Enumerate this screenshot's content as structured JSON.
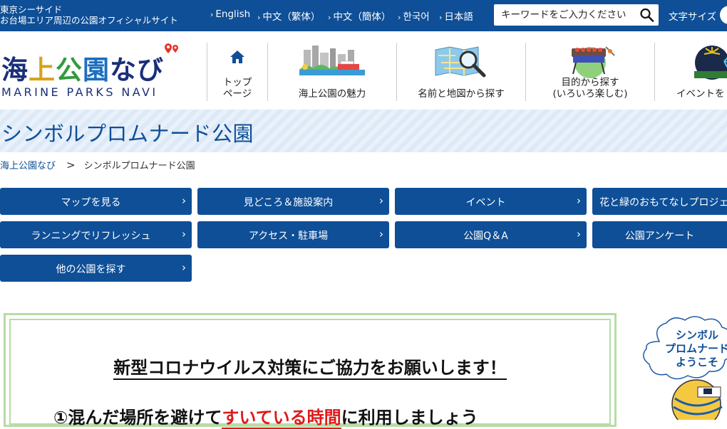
{
  "topbar": {
    "site_tag_line1": "東京シーサイド",
    "site_tag_line2": "お台場エリア周辺の公園オフィシャルサイト",
    "languages": [
      "English",
      "中文（繁体）",
      "中文（簡体）",
      "한국어",
      "日本語"
    ],
    "search_placeholder": "キーワードをご入力ください",
    "font_size_label": "文字サイズ",
    "bar_color": "#0e4f97"
  },
  "logo": {
    "jp_part1": "海",
    "jp_part2": "上",
    "jp_part3": "公",
    "jp_part4": "園",
    "jp_part5": "なび",
    "en": "MARINE PARKS NAVI"
  },
  "gnav": [
    {
      "label_line1": "トップ",
      "label_line2": "ページ",
      "icon": "home-icon"
    },
    {
      "label_line1": "",
      "label_line2": "海上公園の魅力",
      "icon": "city-skyline-icon"
    },
    {
      "label_line1": "",
      "label_line2": "名前と地図から探す",
      "icon": "map-search-icon"
    },
    {
      "label_line1": "目的から探す",
      "label_line2": "(いろいろ楽しむ)",
      "icon": "bbq-grill-icon"
    },
    {
      "label_line1": "",
      "label_line2": "イベントを",
      "icon": "fireworks-icon"
    }
  ],
  "page_title": "シンボルプロムナード公園",
  "breadcrumb": {
    "home": "海上公園なび",
    "separator": ">",
    "current": "シンボルプロムナード公園"
  },
  "park_tabs": [
    "マップを見る",
    "見どころ＆施設案内",
    "イベント",
    "花と緑のおもてなしプロジェクト",
    "ランニングでリフレッシュ",
    "アクセス・駐車場",
    "公園Q＆A",
    "公園アンケート",
    "他の公園を探す"
  ],
  "notice": {
    "title": "新型コロナウイルス対策にご協力をお願いします！",
    "line1_prefix": "①混んだ場所を避けて",
    "line1_emph": "すいている時間",
    "line1_suffix": "に利用しましょう",
    "border_color": "#b7dca6",
    "emph_color": "#e01919"
  },
  "mascot": {
    "bubble_line1": "シンボル",
    "bubble_line2": "プロムナード",
    "bubble_line3": "ようこそ"
  }
}
